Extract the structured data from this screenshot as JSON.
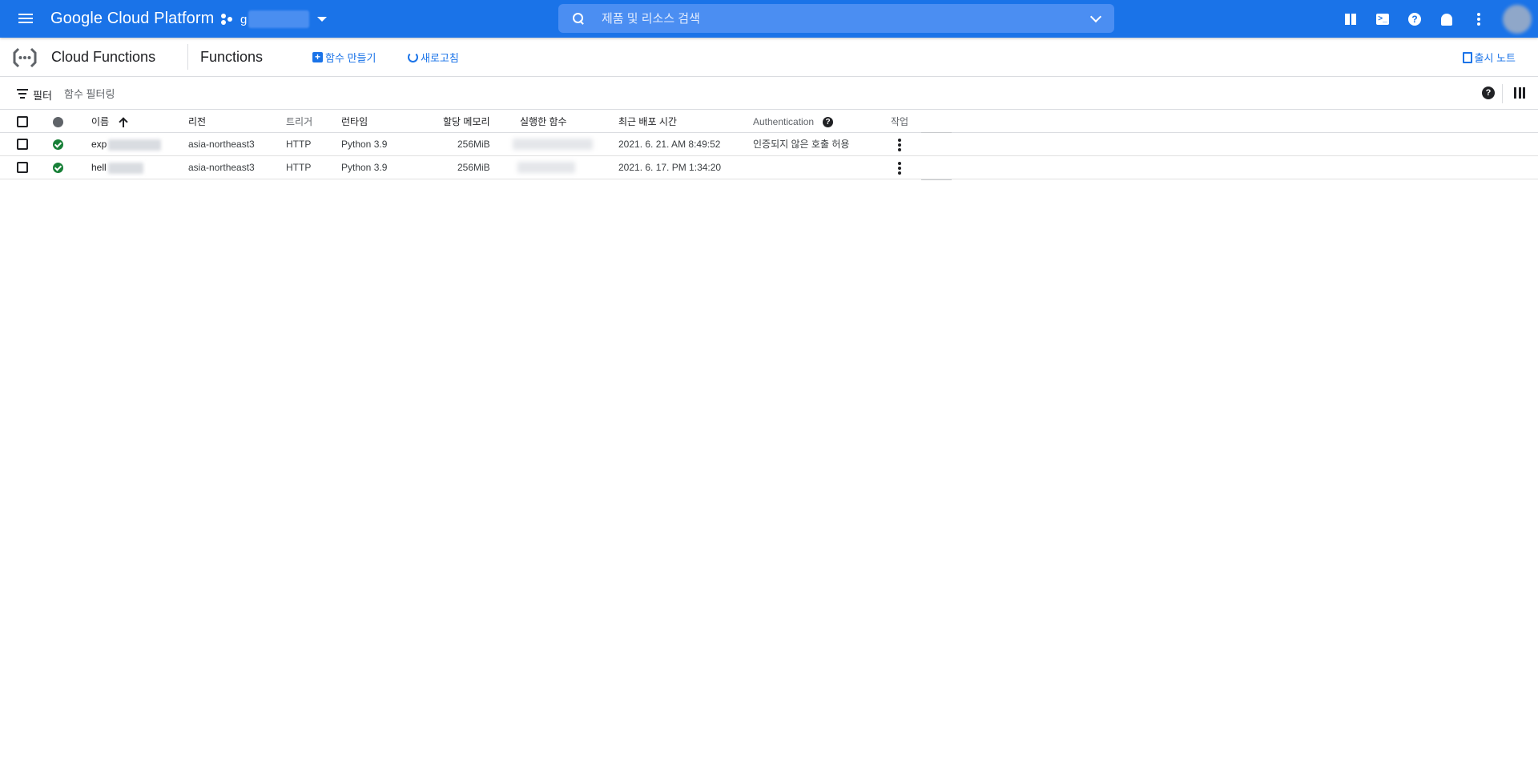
{
  "topbar": {
    "brand": "Google Cloud Platform",
    "project_initial": "g",
    "search_placeholder": "제품 및 리소스 검색",
    "icons": [
      "menu-icon",
      "project-icon",
      "search-icon",
      "gift-icon",
      "terminal-icon",
      "help-icon",
      "bell-icon",
      "more-vert-icon"
    ]
  },
  "subbar": {
    "product_title": "Cloud Functions",
    "page_title": "Functions",
    "create_label": "함수 만들기",
    "refresh_label": "새로고침",
    "release_notes_label": "출시 노트"
  },
  "filter": {
    "label": "필터",
    "placeholder": "함수 필터링"
  },
  "table": {
    "headers": {
      "name": "이름",
      "region": "리전",
      "trigger": "트리거",
      "runtime": "런타임",
      "memory": "할당 메모리",
      "entry_point": "실행한 함수",
      "deployed": "최근 배포 시간",
      "auth": "Authentication",
      "actions": "작업"
    },
    "rows": [
      {
        "name": "exp",
        "region": "asia-northeast3",
        "trigger": "HTTP",
        "runtime": "Python 3.9",
        "memory": "256MiB",
        "deployed": "2021. 6. 21. AM 8:49:52",
        "auth": "인증되지 않은 호출 허용"
      },
      {
        "name": "hell",
        "region": "asia-northeast3",
        "trigger": "HTTP",
        "runtime": "Python 3.9",
        "memory": "256MiB",
        "deployed": "2021. 6. 17. PM 1:34:20",
        "auth": ""
      }
    ]
  },
  "colors": {
    "brand_blue": "#1a73e8",
    "status_ok": "#188038"
  }
}
